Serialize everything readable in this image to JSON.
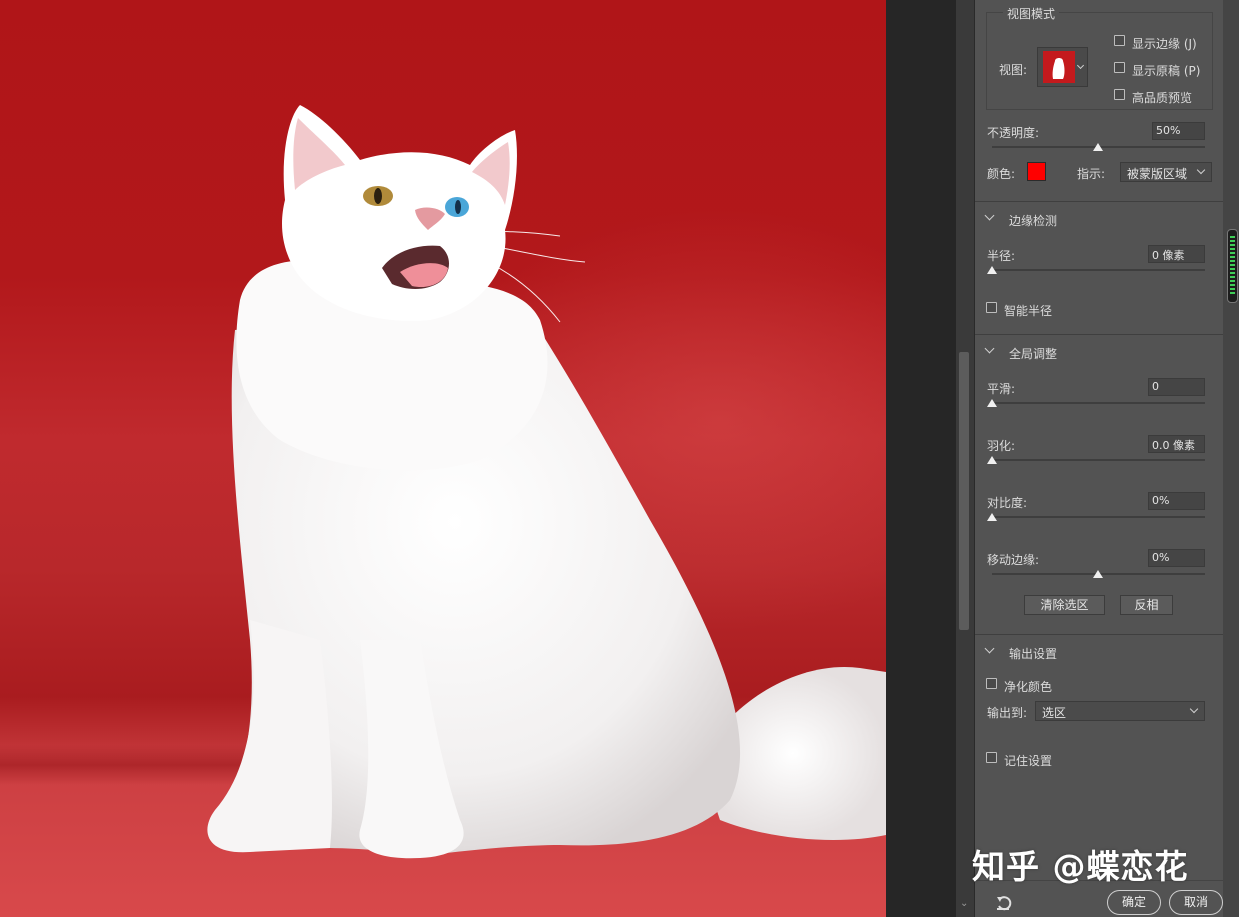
{
  "view_mode": {
    "section_title": "视图模式",
    "view_label": "视图:",
    "show_edge": {
      "label": "显示边缘 (J)",
      "checked": false
    },
    "show_original": {
      "label": "显示原稿 (P)",
      "checked": false
    },
    "high_quality_preview": {
      "label": "高品质预览",
      "checked": false
    }
  },
  "opacity": {
    "label": "不透明度:",
    "value": "50%",
    "level": 0.5
  },
  "color": {
    "label": "颜色:",
    "swatch": "#ff0000"
  },
  "indicate": {
    "label": "指示:",
    "value": "被蒙版区域"
  },
  "edge_detection": {
    "title": "边缘检测",
    "radius": {
      "label": "半径:",
      "value": "0 像素",
      "level": 0
    },
    "smart_radius": {
      "label": "智能半径",
      "checked": false
    }
  },
  "global_refine": {
    "title": "全局调整",
    "smooth": {
      "label": "平滑:",
      "value": "0",
      "level": 0
    },
    "feather": {
      "label": "羽化:",
      "value": "0.0 像素",
      "level": 0
    },
    "contrast": {
      "label": "对比度:",
      "value": "0%",
      "level": 0
    },
    "shift_edge": {
      "label": "移动边缘:",
      "value": "0%",
      "level": 0.5
    },
    "clear_selection_label": "清除选区",
    "invert_label": "反相"
  },
  "output": {
    "title": "输出设置",
    "decontaminate": {
      "label": "净化颜色",
      "checked": false
    },
    "output_to_label": "输出到:",
    "output_to_value": "选区",
    "remember": {
      "label": "记住设置",
      "checked": false
    }
  },
  "footer": {
    "ok_label": "确定",
    "cancel_label": "取消",
    "reset_icon": "reset-icon"
  },
  "watermark": "知乎 @蝶恋花",
  "colors": {
    "canvas_red": "#b01518",
    "panel_bg": "#535353",
    "swatch_red": "#ff0000"
  }
}
